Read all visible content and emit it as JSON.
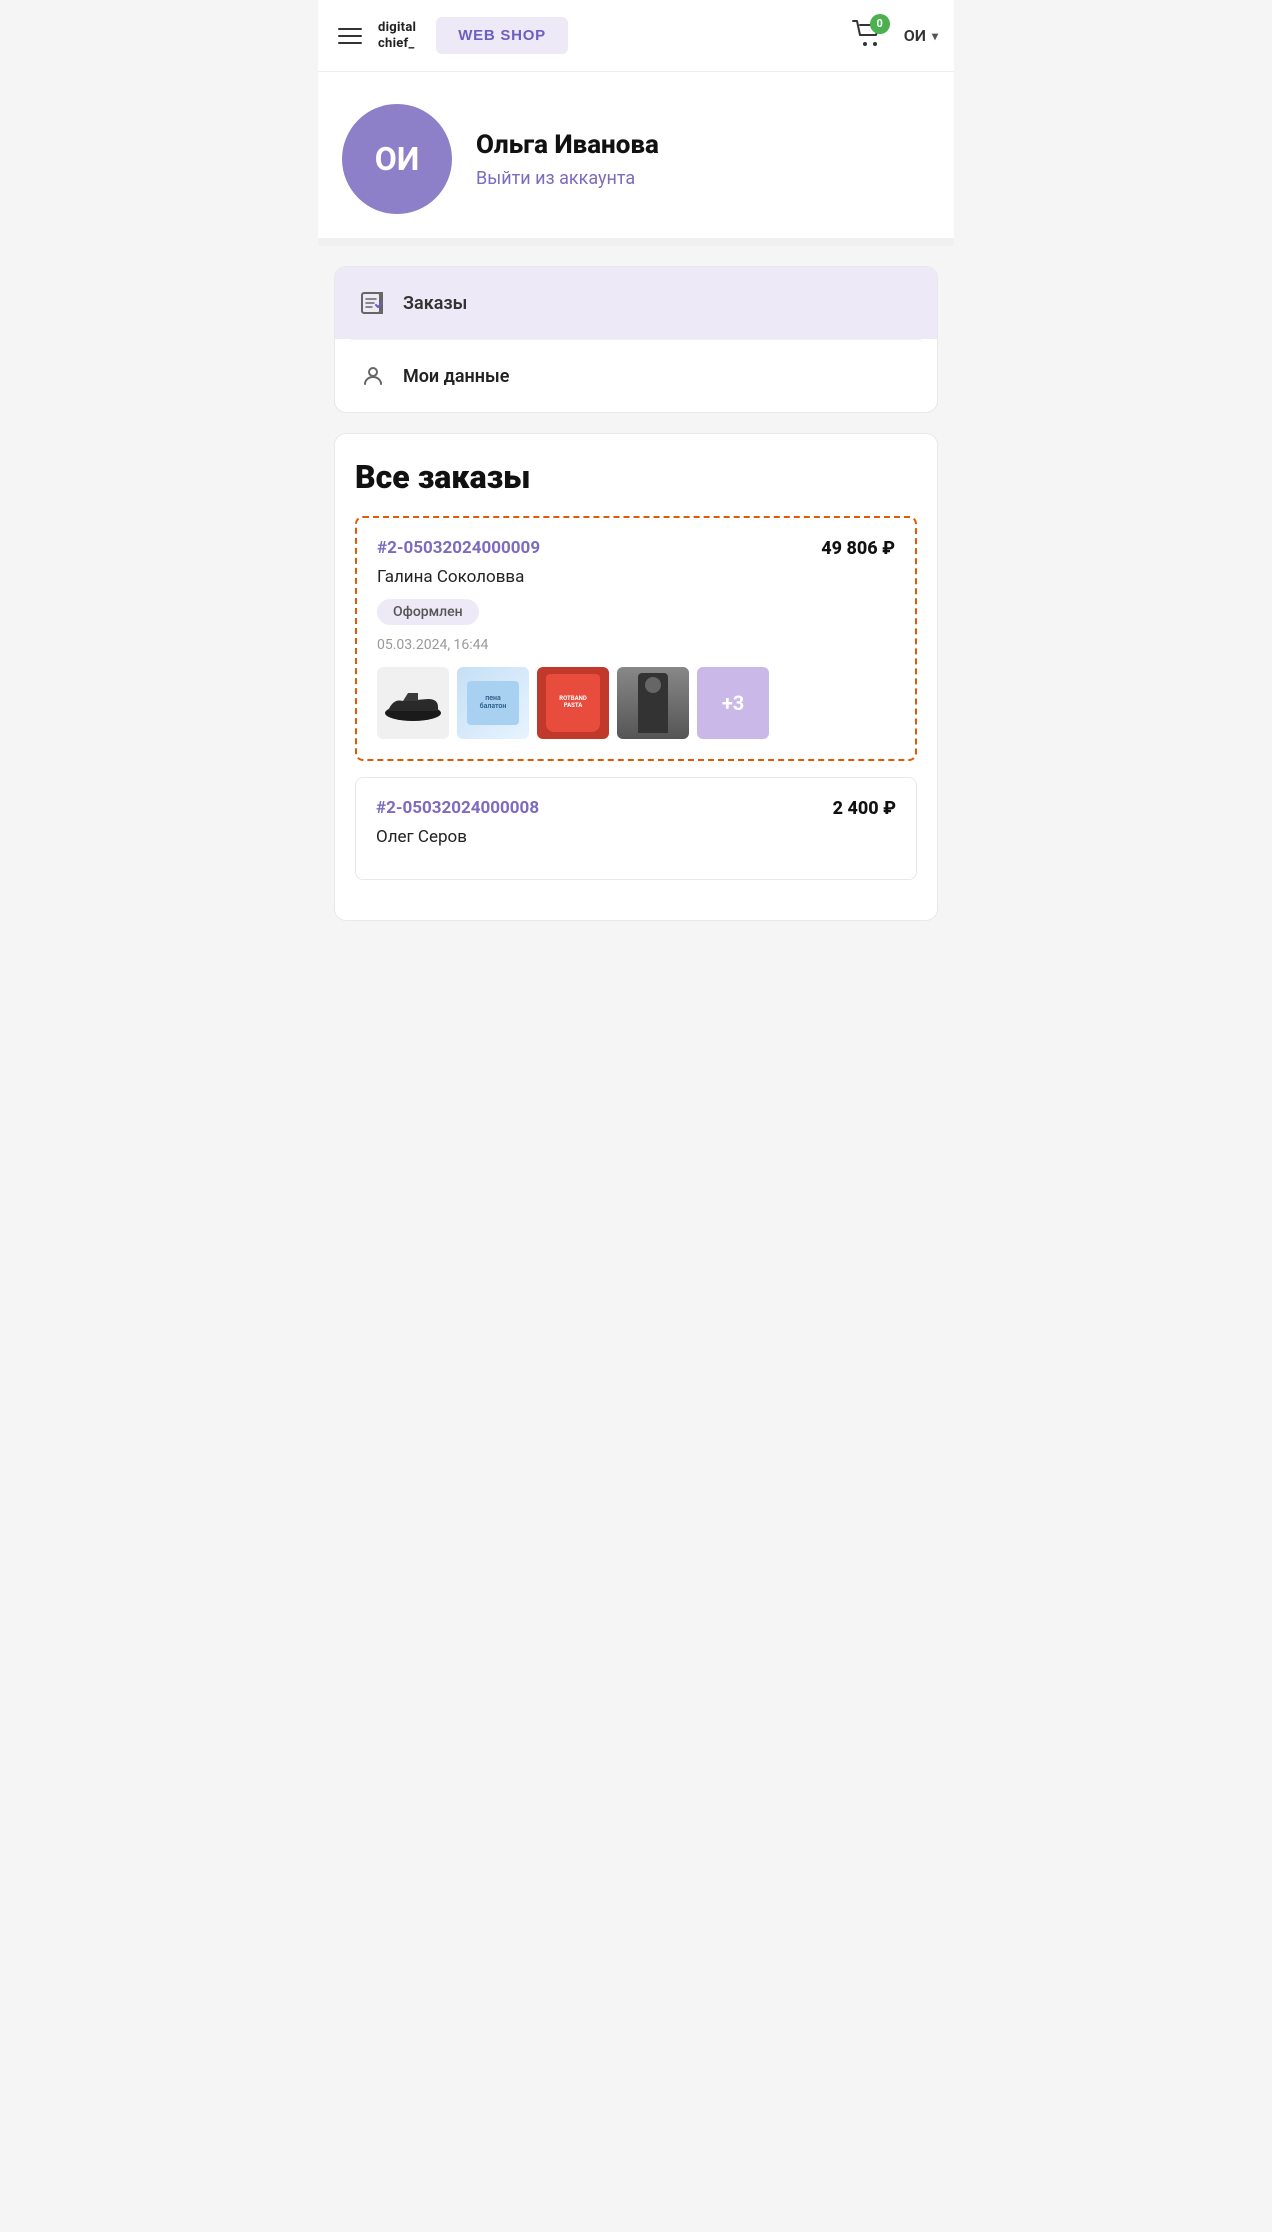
{
  "header": {
    "menu_label": "menu",
    "brand_line1": "digital",
    "brand_line2": "chief_",
    "webshop_label": "WEB SHOP",
    "cart_count": "0",
    "user_initials": "ОИ"
  },
  "profile": {
    "avatar_initials": "ОИ",
    "name": "Ольга Иванова",
    "logout_label": "Выйти из аккаунта"
  },
  "nav": {
    "orders_label": "Заказы",
    "mydata_label": "Мои данные"
  },
  "orders": {
    "title": "Все заказы",
    "items": [
      {
        "number": "#2-05032024000009",
        "price": "49 806 ₽",
        "customer": "Галина Соколовва",
        "status": "Оформлен",
        "date": "05.03.2024, 16:44",
        "extra_count": "+3",
        "highlighted": true
      },
      {
        "number": "#2-05032024000008",
        "price": "2 400 ₽",
        "customer": "Олег Серов",
        "status": "",
        "date": "",
        "extra_count": "",
        "highlighted": false
      }
    ]
  }
}
